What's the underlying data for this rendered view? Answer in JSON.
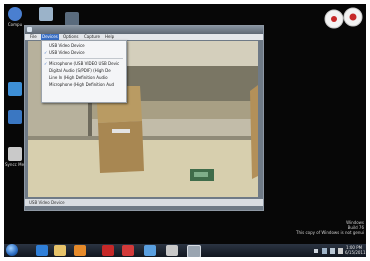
{
  "desktop_icons": [
    {
      "label": "Compu",
      "icon": "computer-icon",
      "color": "#4a7fd0"
    },
    {
      "label": "",
      "icon": "recycle-bin-icon",
      "color": "#9bb3c9"
    },
    {
      "label": "",
      "icon": "network-icon",
      "color": "#5a6b7d"
    },
    {
      "label": "",
      "icon": "program-icon",
      "color": "#3d8fd6"
    },
    {
      "label": "",
      "icon": "program-icon",
      "color": "#3a77c2"
    },
    {
      "label": "Syncc Memo",
      "icon": "sync-icon",
      "color": "#c9c9c9"
    }
  ],
  "window": {
    "menu": [
      "File",
      "Devices",
      "Options",
      "Capture",
      "Help"
    ],
    "status": "USB Video Device"
  },
  "devices_menu": {
    "items": [
      {
        "label": "USB Video Device",
        "checked": false
      },
      {
        "label": "USB Video Device",
        "checked": true
      },
      {
        "label": "Microphone (USB VIDEO USB Devic",
        "checked": true
      },
      {
        "label": "Digital Audio (S/PDIF) (High De",
        "checked": false
      },
      {
        "label": "Line In (High Definition Audio",
        "checked": false
      },
      {
        "label": "Microphone (High Definition Aud",
        "checked": false
      }
    ],
    "check_glyph": "✓"
  },
  "tray": {
    "notice_line1": "Windows",
    "notice_line2": "Build 76",
    "notice_line3": "This copy of Windows is not genui",
    "time": "1:00 PM",
    "date": "6/15/2011"
  },
  "taskbar_apps": [
    {
      "icon": "internet-explorer-icon",
      "color": "#2f7fd8"
    },
    {
      "icon": "folder-icon",
      "color": "#e6c36a"
    },
    {
      "icon": "media-player-icon",
      "color": "#e58a2a"
    },
    {
      "icon": "acrobat-icon",
      "color": "#c62828"
    },
    {
      "icon": "app-icon",
      "color": "#d33a3a"
    },
    {
      "icon": "app-icon",
      "color": "#5aa0e0"
    },
    {
      "icon": "app-icon",
      "color": "#c8c8c8"
    },
    {
      "icon": "capture-app-icon",
      "color": "#9aa5b1"
    }
  ]
}
